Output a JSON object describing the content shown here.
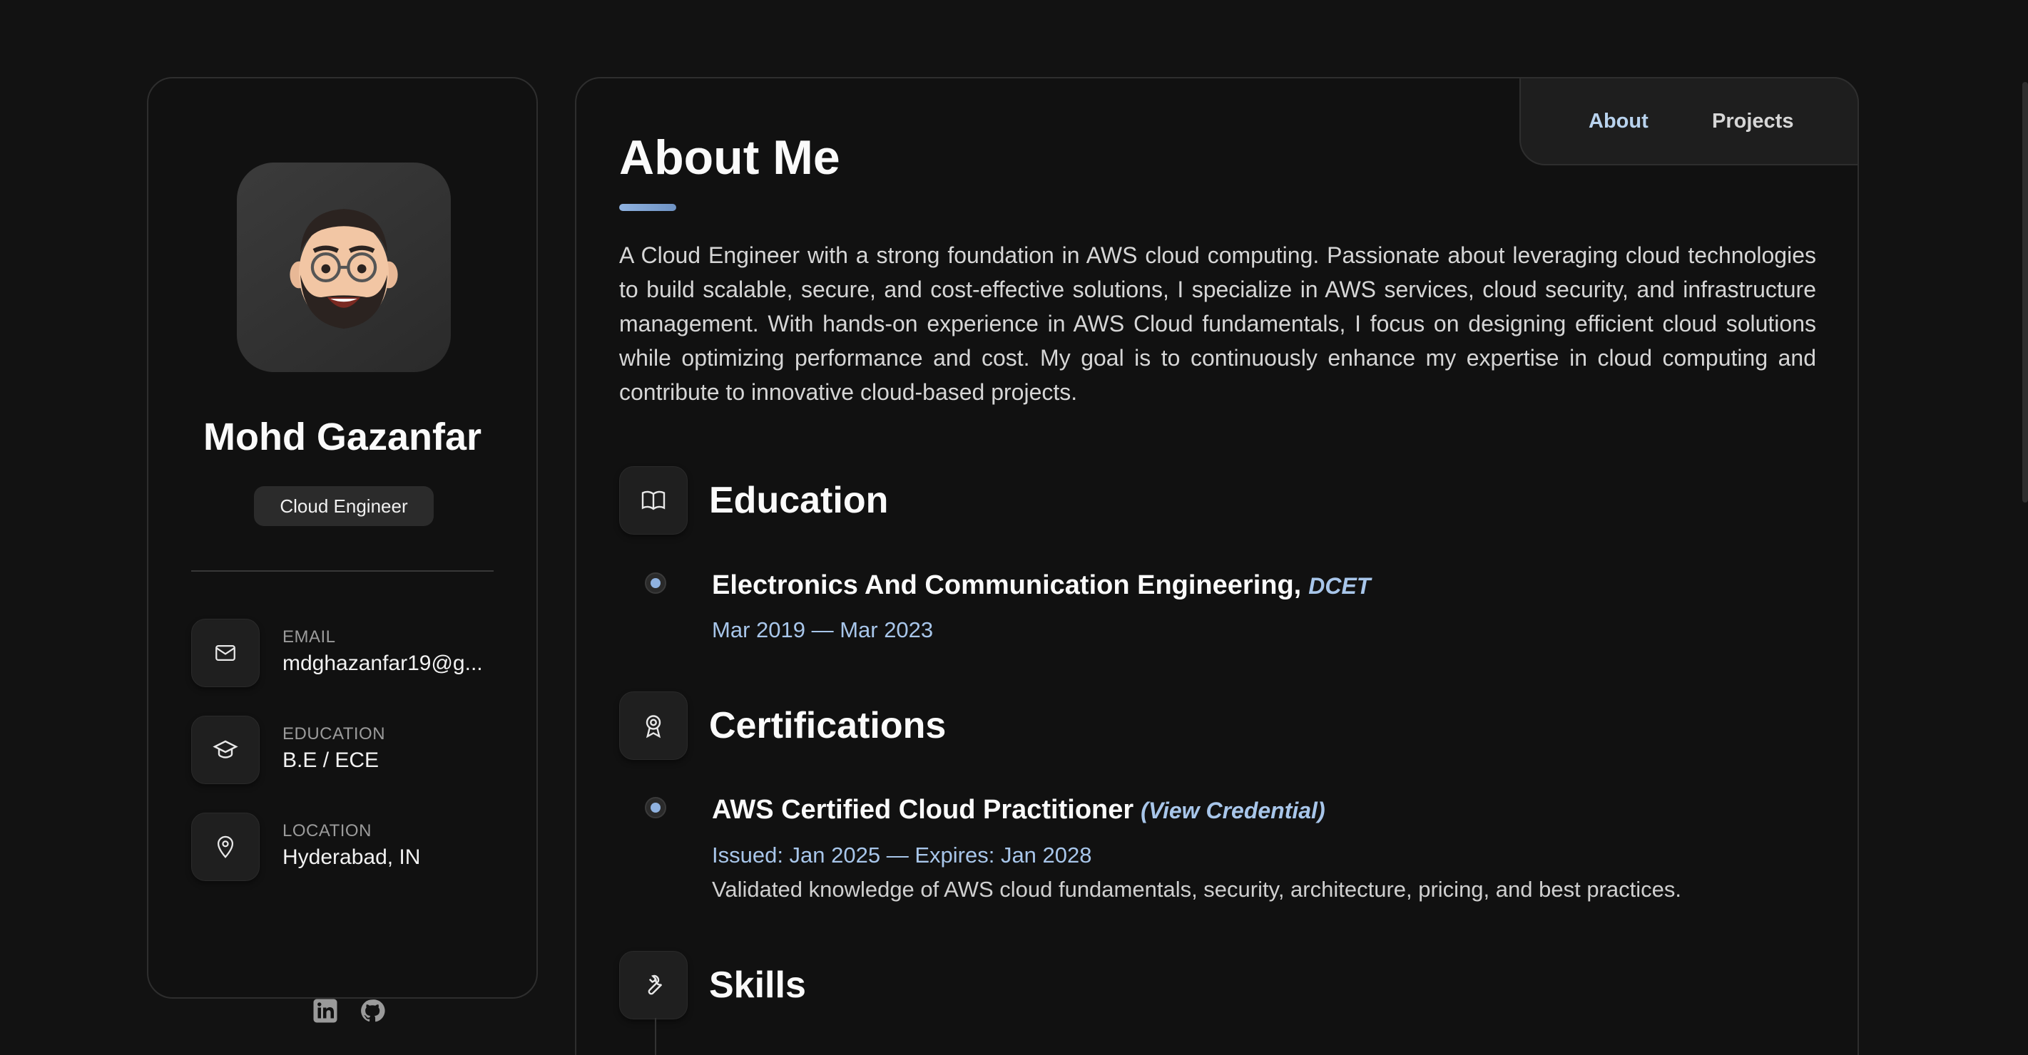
{
  "profile": {
    "name": "Mohd Gazanfar",
    "role": "Cloud Engineer",
    "avatar_icon": "memoji-avatar"
  },
  "contacts": [
    {
      "icon": "mail-icon",
      "label": "EMAIL",
      "value": "mdghazanfar19@g..."
    },
    {
      "icon": "graduation-cap-icon",
      "label": "EDUCATION",
      "value": "B.E / ECE"
    },
    {
      "icon": "map-pin-icon",
      "label": "LOCATION",
      "value": "Hyderabad, IN"
    }
  ],
  "socials": [
    "linkedin-icon",
    "github-icon"
  ],
  "nav": {
    "about": "About",
    "projects": "Projects",
    "active": "About"
  },
  "about": {
    "title": "About Me",
    "text": "A Cloud Engineer with a strong foundation in AWS cloud computing. Passionate about leveraging cloud technologies to build scalable, secure, and cost-effective solutions, I specialize in AWS services, cloud security, and infrastructure management. With hands-on experience in AWS Cloud fundamentals, I focus on designing efficient cloud solutions while optimizing performance and cost. My goal is to continuously enhance my expertise in cloud computing and contribute to innovative cloud-based projects."
  },
  "education": {
    "title": "Education",
    "items": [
      {
        "degree": "Electronics And Communication Engineering,",
        "institution": "DCET",
        "dates": "Mar 2019 — Mar 2023"
      }
    ]
  },
  "certifications": {
    "title": "Certifications",
    "items": [
      {
        "name": "AWS Certified Cloud Practitioner",
        "link": "(View Credential)",
        "dates": "Issued: Jan 2025 — Expires: Jan 2028",
        "description": "Validated knowledge of AWS cloud fundamentals, security, architecture, pricing, and best practices."
      }
    ]
  },
  "skills": {
    "title": "Skills"
  },
  "colors": {
    "background": "#121212",
    "card": "#111111",
    "accent": "#a8c6ea",
    "text": "#fafafa"
  }
}
